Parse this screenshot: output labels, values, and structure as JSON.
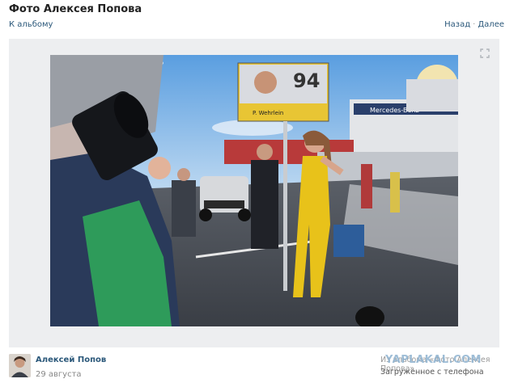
{
  "header": {
    "title": "Фото Алексея Попова",
    "back_link": "К альбому",
    "nav_back": "Назад",
    "nav_separator": "·",
    "nav_next": "Далее"
  },
  "photo": {
    "sign_number": "94",
    "sign_name": "P. Wehrlein",
    "banner_text": "Mercedes-Benz",
    "expand_icon": "expand-icon"
  },
  "footer": {
    "author": "Алексей Попов",
    "date": "29 августа",
    "album_info": "Из альбома «Фото Алексея Попова»",
    "upload_info": "Загруженное с телефона",
    "watermark": "YAPLAKAL.COM"
  },
  "colors": {
    "link": "#2b587a",
    "frame_bg": "#edeef0",
    "sign_yellow": "#e8c534",
    "suit_yellow": "#e8c21a"
  }
}
